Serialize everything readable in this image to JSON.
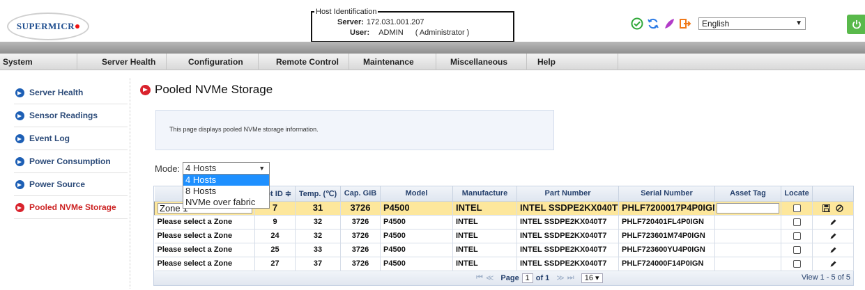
{
  "header": {
    "logo_text": "SUPERMICR",
    "host_legend": "Host Identification",
    "server_label": "Server:",
    "server_value": "172.031.001.207",
    "user_label": "User:",
    "user_value": "ADMIN",
    "role": "( Administrator )",
    "language": "English",
    "icons": [
      "check-circle-icon",
      "refresh-icon",
      "feather-icon",
      "logout-icon",
      "power-icon"
    ],
    "colors": {
      "green": "#2fa838",
      "blue": "#2c7be5",
      "purple": "#b23cc8",
      "orange": "#f07a1a"
    }
  },
  "menu": [
    "System",
    "Server Health",
    "Configuration",
    "Remote Control",
    "Maintenance",
    "Miscellaneous",
    "Help"
  ],
  "sidebar": {
    "items": [
      {
        "label": "Server Health",
        "active": false
      },
      {
        "label": "Sensor Readings",
        "active": false
      },
      {
        "label": "Event Log",
        "active": false
      },
      {
        "label": "Power Consumption",
        "active": false
      },
      {
        "label": "Power Source",
        "active": false
      },
      {
        "label": "Pooled NVMe Storage",
        "active": true
      }
    ]
  },
  "main": {
    "title": "Pooled NVMe Storage",
    "info": "This page displays pooled NVMe storage information.",
    "mode_label": "Mode:",
    "mode_selected": "4 Hosts",
    "mode_options": [
      "4 Hosts",
      "8 Hosts",
      "NVMe over fabric"
    ]
  },
  "table": {
    "columns": [
      "",
      "Slot ID",
      "Temp. (℃)",
      "Cap. GiB",
      "Model",
      "Manufacture",
      "Part Number",
      "Serial Number",
      "Asset Tag",
      "Locate",
      ""
    ],
    "rows": [
      {
        "zone": "Zone 1",
        "slot": "7",
        "temp": "31",
        "cap": "3726",
        "model": "P4500",
        "mfr": "INTEL",
        "part": "INTEL SSDPE2KX040T7",
        "serial": "PHLF7200017P4P0IGN"
      },
      {
        "zone": "Please select a Zone",
        "slot": "9",
        "temp": "32",
        "cap": "3726",
        "model": "P4500",
        "mfr": "INTEL",
        "part": "INTEL SSDPE2KX040T7",
        "serial": "PHLF720401FL4P0IGN"
      },
      {
        "zone": "Please select a Zone",
        "slot": "24",
        "temp": "32",
        "cap": "3726",
        "model": "P4500",
        "mfr": "INTEL",
        "part": "INTEL SSDPE2KX040T7",
        "serial": "PHLF723601M74P0IGN"
      },
      {
        "zone": "Please select a Zone",
        "slot": "25",
        "temp": "33",
        "cap": "3726",
        "model": "P4500",
        "mfr": "INTEL",
        "part": "INTEL SSDPE2KX040T7",
        "serial": "PHLF723600YU4P0IGN"
      },
      {
        "zone": "Please select a Zone",
        "slot": "27",
        "temp": "37",
        "cap": "3726",
        "model": "P4500",
        "mfr": "INTEL",
        "part": "INTEL SSDPE2KX040T7",
        "serial": "PHLF724000F14P0IGN"
      }
    ],
    "pager": {
      "page_label": "Page",
      "page": "1",
      "of_label": "of 1",
      "rows_per_page": "16",
      "view": "View 1 - 5 of 5"
    }
  }
}
